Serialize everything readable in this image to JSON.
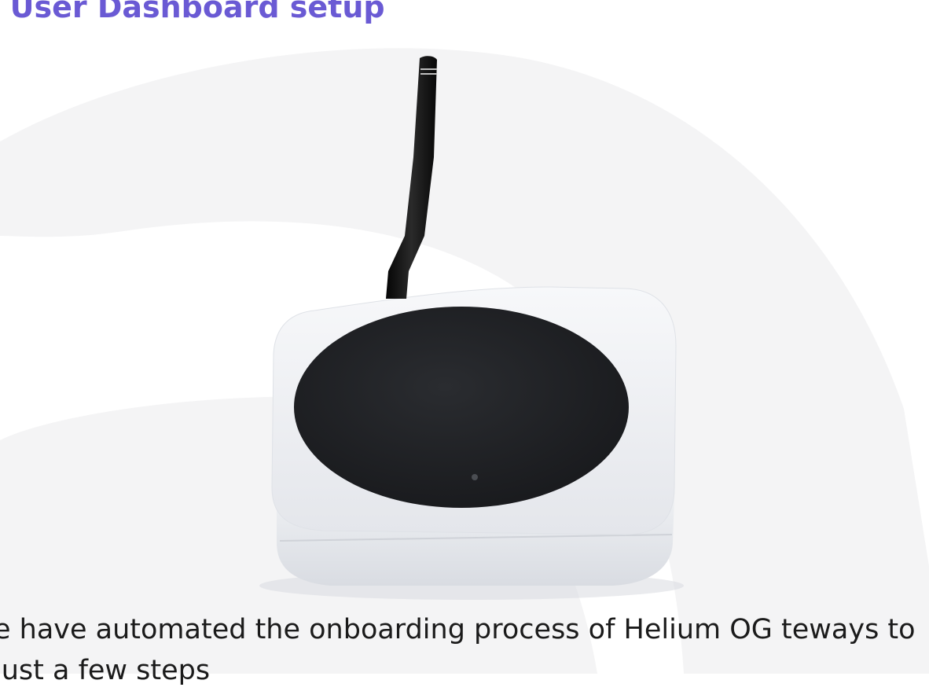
{
  "heading": {
    "text": ") User Dashboard setup",
    "color": "#6a5ad4"
  },
  "body": {
    "text": "e have automated the onboarding process of Helium OG teways to just a few steps"
  },
  "image": {
    "subject": "LoRa gateway device with antenna",
    "colors": {
      "case": "#eceef2",
      "top_disc": "#1f2124",
      "antenna": "#141414",
      "background_shape": "#f4f4f5"
    }
  }
}
